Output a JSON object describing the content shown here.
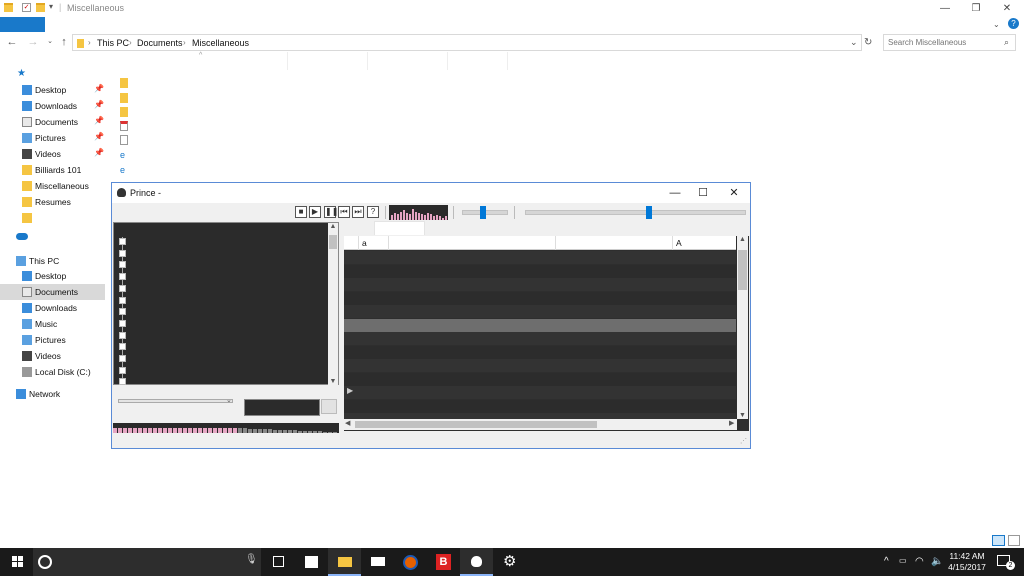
{
  "explorer": {
    "window_title": "Miscellaneous",
    "breadcrumbs": [
      "This PC",
      "Documents",
      "Miscellaneous"
    ],
    "search_placeholder": "Search Miscellaneous",
    "quick_access": [
      {
        "label": "Desktop",
        "pinned": true
      },
      {
        "label": "Downloads",
        "pinned": true
      },
      {
        "label": "Documents",
        "pinned": true
      },
      {
        "label": "Pictures",
        "pinned": true
      },
      {
        "label": "Videos",
        "pinned": true
      },
      {
        "label": "Billiards 101",
        "pinned": false
      },
      {
        "label": "Miscellaneous",
        "pinned": false
      },
      {
        "label": "Resumes",
        "pinned": false
      }
    ],
    "this_pc_label": "This PC",
    "this_pc_items": [
      "Desktop",
      "Documents",
      "Downloads",
      "Music",
      "Pictures",
      "Videos",
      "Local Disk (C:)"
    ],
    "network_label": "Network"
  },
  "prince": {
    "title": "Prince -",
    "list_columns": {
      "col1": "a",
      "col2": "A"
    },
    "spectrum_levels": [
      0.4,
      0.6,
      0.5,
      0.7,
      0.8,
      0.6,
      0.5,
      0.9,
      0.7,
      0.6,
      0.5,
      0.4,
      0.6,
      0.5,
      0.3,
      0.4,
      0.3,
      0.2,
      0.3
    ],
    "volume_level": 0.45,
    "seek_level": 0.56
  },
  "taskbar": {
    "time": "11:42 AM",
    "date": "4/15/2017",
    "notification_count": "2"
  }
}
